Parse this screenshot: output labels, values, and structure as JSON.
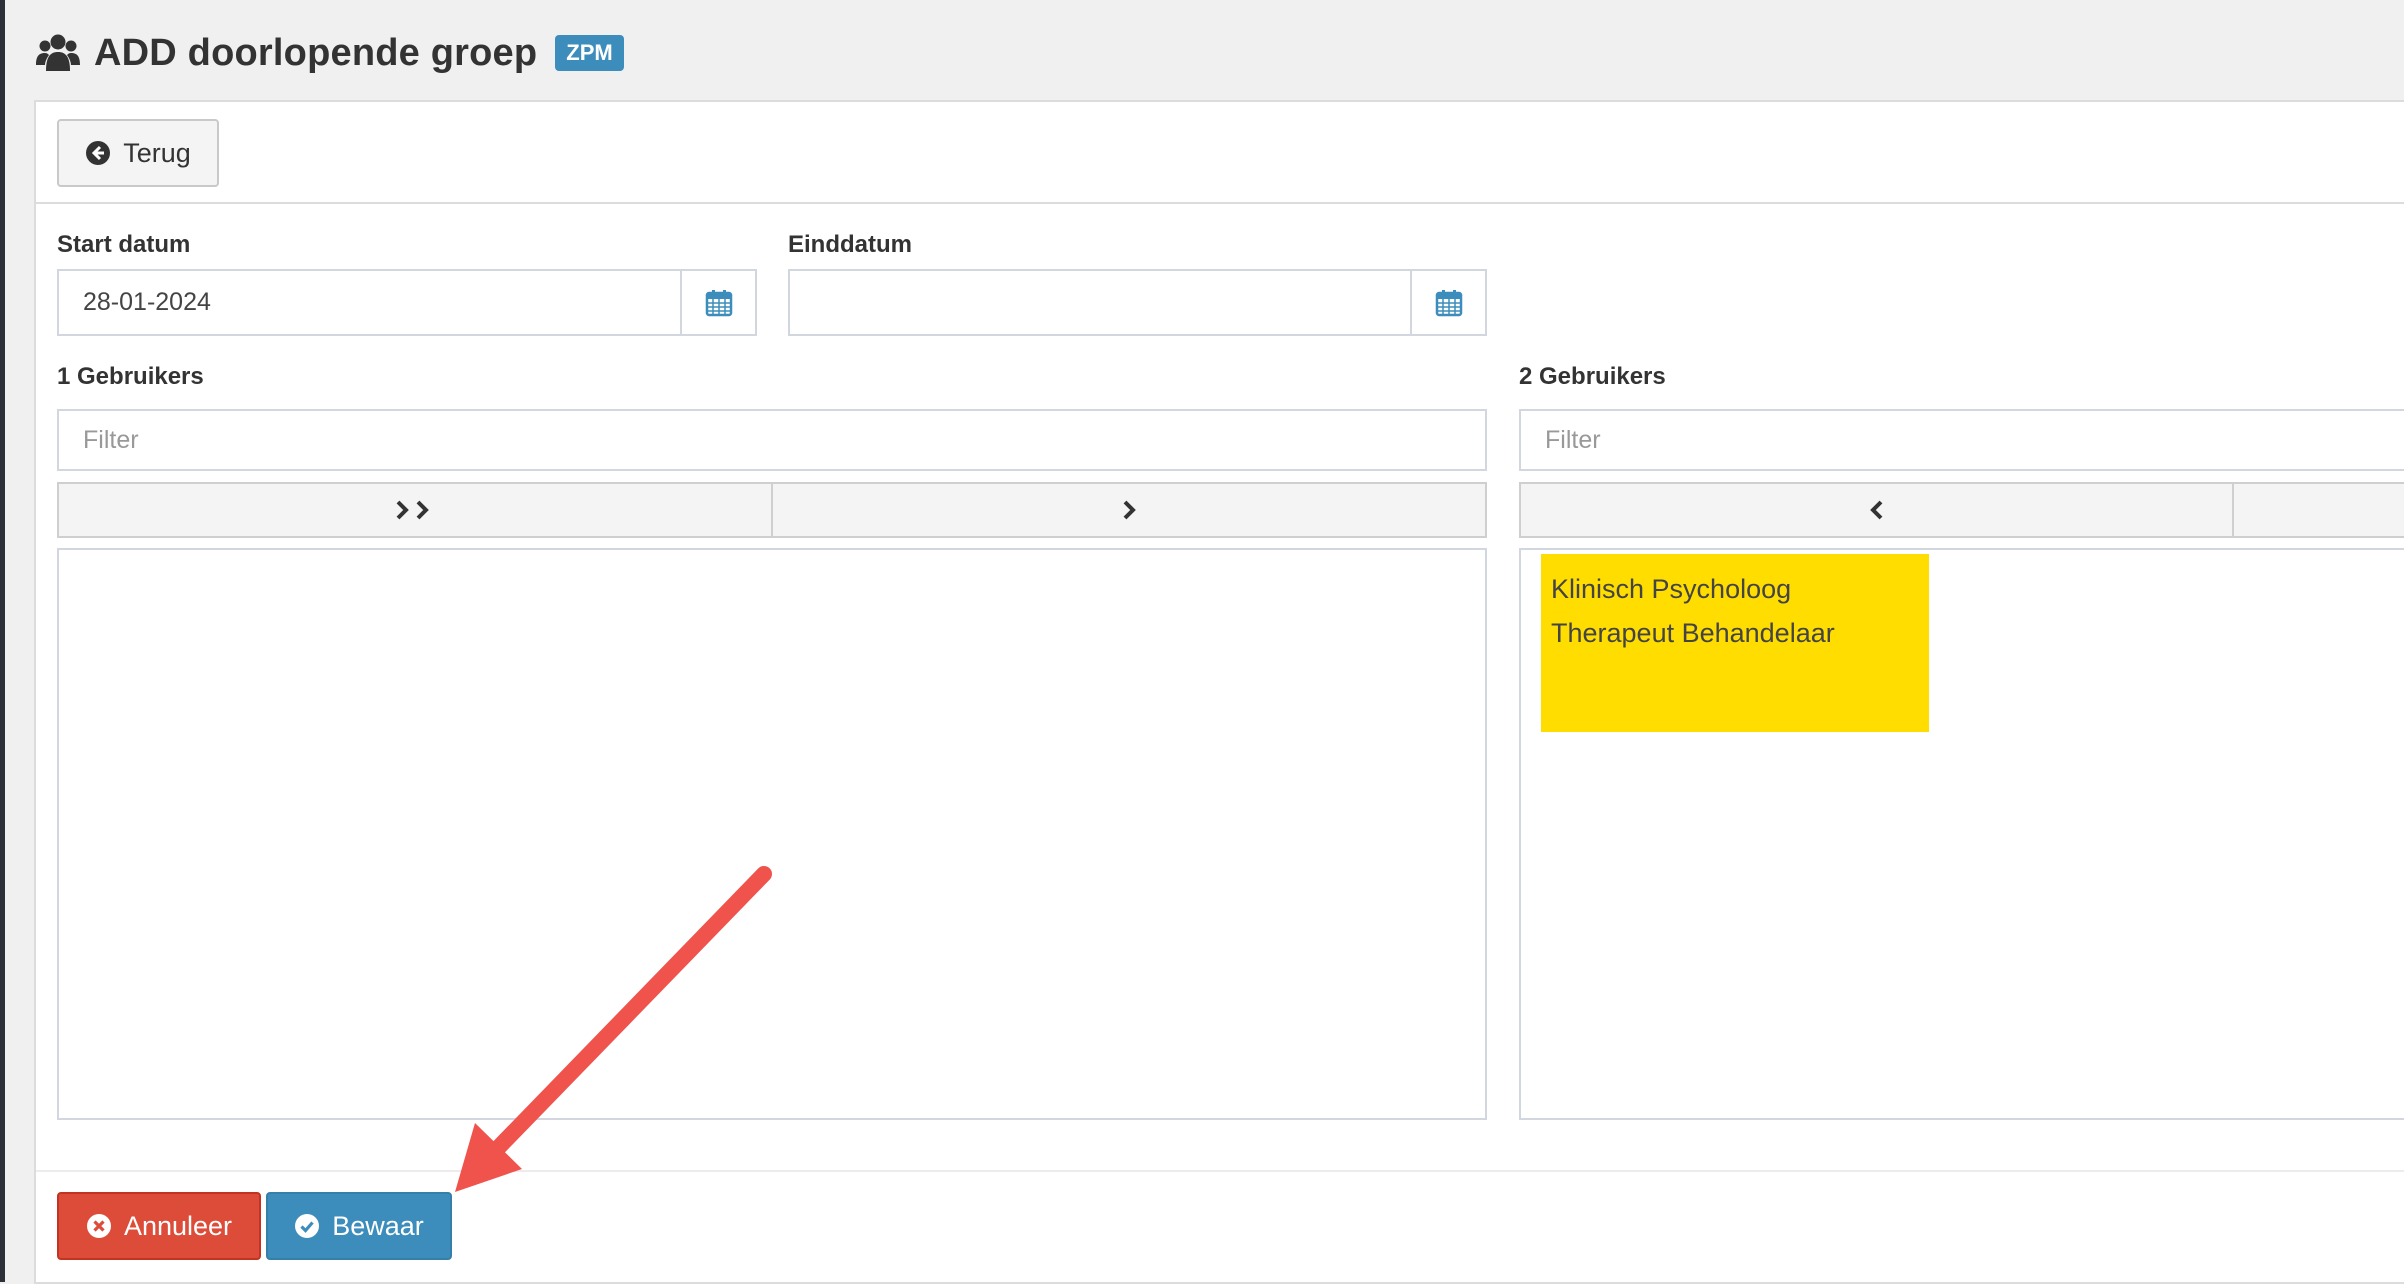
{
  "header": {
    "title": "ADD doorlopende groep",
    "badge": "ZPM",
    "icon": "users-icon"
  },
  "toolbar": {
    "back_label": "Terug",
    "back_icon": "arrow-circle-left-icon"
  },
  "form": {
    "start_label": "Start datum",
    "start_value": "28-01-2024",
    "end_label": "Einddatum",
    "end_value": "",
    "calendar_icon": "calendar-icon"
  },
  "left_list": {
    "heading": "1 Gebruikers",
    "filter_placeholder": "Filter",
    "move_all_icon": "double-chevron-right-icon",
    "move_icon": "chevron-right-icon",
    "items": []
  },
  "right_list": {
    "heading": "2 Gebruikers",
    "filter_placeholder": "Filter",
    "move_icon": "chevron-left-icon",
    "items": [
      "Klinisch Psycholoog",
      "Therapeut Behandelaar"
    ],
    "highlight_color": "#ffdd00"
  },
  "footer": {
    "cancel_label": "Annuleer",
    "cancel_icon": "times-circle-icon",
    "save_label": "Bewaar",
    "save_icon": "check-circle-icon"
  },
  "colors": {
    "primary": "#3c8dbc",
    "danger": "#dd4b39",
    "annotation_arrow": "#f0524c"
  }
}
